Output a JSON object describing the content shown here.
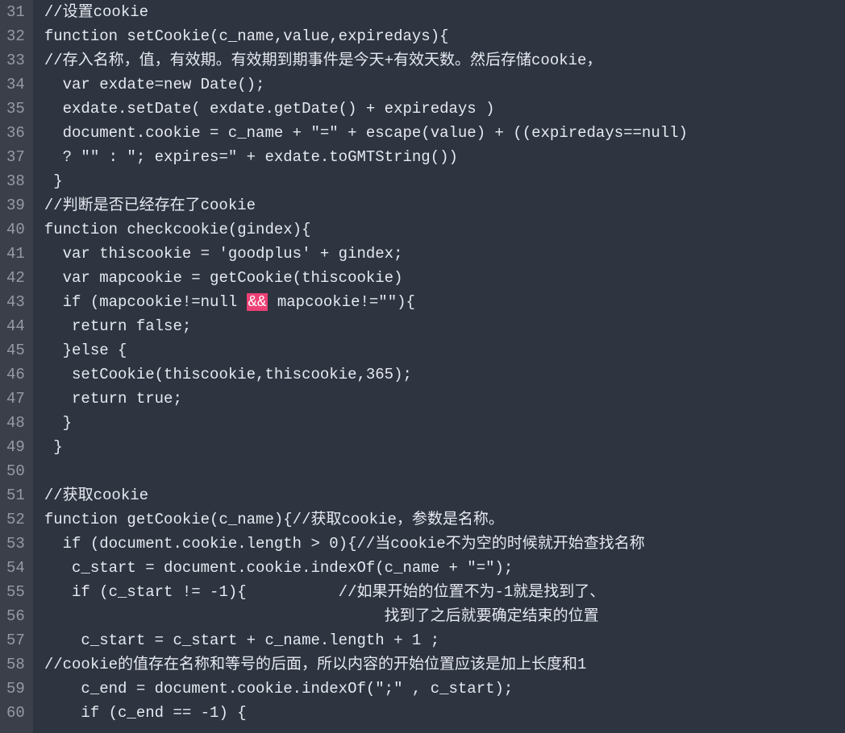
{
  "lines": [
    {
      "num": "31",
      "tokens": [
        {
          "t": "//设置cookie",
          "c": "cmt"
        }
      ]
    },
    {
      "num": "32",
      "tokens": [
        {
          "t": "function setCookie(c_name,value,expiredays){",
          "c": "txt"
        }
      ]
    },
    {
      "num": "33",
      "tokens": [
        {
          "t": "//存入名称，值，有效期。有效期到期事件是今天+有效天数。然后存储cookie，",
          "c": "cmt"
        }
      ]
    },
    {
      "num": "34",
      "tokens": [
        {
          "t": "  var exdate=new Date();",
          "c": "txt"
        }
      ]
    },
    {
      "num": "35",
      "tokens": [
        {
          "t": "  exdate.setDate( exdate.getDate() + expiredays )",
          "c": "txt"
        }
      ]
    },
    {
      "num": "36",
      "tokens": [
        {
          "t": "  document.cookie = c_name + \"=\" + escape(value) + ((expiredays==null)",
          "c": "txt"
        }
      ]
    },
    {
      "num": "37",
      "tokens": [
        {
          "t": "  ? \"\" : \"; expires=\" + exdate.toGMTString())",
          "c": "txt"
        }
      ]
    },
    {
      "num": "38",
      "tokens": [
        {
          "t": " }",
          "c": "txt"
        }
      ]
    },
    {
      "num": "39",
      "tokens": [
        {
          "t": "//判断是否已经存在了cookie",
          "c": "cmt"
        }
      ]
    },
    {
      "num": "40",
      "tokens": [
        {
          "t": "function checkcookie(gindex){",
          "c": "txt"
        }
      ]
    },
    {
      "num": "41",
      "tokens": [
        {
          "t": "  var thiscookie = 'goodplus' + gindex;",
          "c": "txt"
        }
      ]
    },
    {
      "num": "42",
      "tokens": [
        {
          "t": "  var mapcookie = getCookie(thiscookie)",
          "c": "txt"
        }
      ]
    },
    {
      "num": "43",
      "tokens": [
        {
          "t": "  if (mapcookie!=null ",
          "c": "txt"
        },
        {
          "t": "&&",
          "c": "op-highlight"
        },
        {
          "t": " mapcookie!=\"\"){",
          "c": "txt"
        }
      ]
    },
    {
      "num": "44",
      "tokens": [
        {
          "t": "   return false;",
          "c": "txt"
        }
      ]
    },
    {
      "num": "45",
      "tokens": [
        {
          "t": "  }else {",
          "c": "txt"
        }
      ]
    },
    {
      "num": "46",
      "tokens": [
        {
          "t": "   setCookie(thiscookie,thiscookie,365);",
          "c": "txt"
        }
      ]
    },
    {
      "num": "47",
      "tokens": [
        {
          "t": "   return true;",
          "c": "txt"
        }
      ]
    },
    {
      "num": "48",
      "tokens": [
        {
          "t": "  }",
          "c": "txt"
        }
      ]
    },
    {
      "num": "49",
      "tokens": [
        {
          "t": " }",
          "c": "txt"
        }
      ]
    },
    {
      "num": "50",
      "tokens": [
        {
          "t": "",
          "c": "txt"
        }
      ]
    },
    {
      "num": "51",
      "tokens": [
        {
          "t": "//获取cookie",
          "c": "cmt"
        }
      ]
    },
    {
      "num": "52",
      "tokens": [
        {
          "t": "function getCookie(c_name){//获取cookie，参数是名称。",
          "c": "txt"
        }
      ]
    },
    {
      "num": "53",
      "tokens": [
        {
          "t": "  if (document.cookie.length > 0){//当cookie不为空的时候就开始查找名称",
          "c": "txt"
        }
      ]
    },
    {
      "num": "54",
      "tokens": [
        {
          "t": "   c_start = document.cookie.indexOf(c_name + \"=\");",
          "c": "txt"
        }
      ]
    },
    {
      "num": "55",
      "tokens": [
        {
          "t": "   if (c_start != -1){          //如果开始的位置不为-1就是找到了、",
          "c": "txt"
        }
      ]
    },
    {
      "num": "56",
      "tokens": [
        {
          "t": "                                     找到了之后就要确定结束的位置",
          "c": "txt"
        }
      ]
    },
    {
      "num": "57",
      "tokens": [
        {
          "t": "    c_start = c_start + c_name.length + 1 ;",
          "c": "txt"
        }
      ]
    },
    {
      "num": "58",
      "tokens": [
        {
          "t": "//cookie的值存在名称和等号的后面，所以内容的开始位置应该是加上长度和1",
          "c": "cmt"
        }
      ]
    },
    {
      "num": "59",
      "tokens": [
        {
          "t": "    c_end = document.cookie.indexOf(\";\" , c_start);",
          "c": "txt"
        }
      ]
    },
    {
      "num": "60",
      "tokens": [
        {
          "t": "    if (c_end == -1) {",
          "c": "txt"
        }
      ]
    }
  ]
}
